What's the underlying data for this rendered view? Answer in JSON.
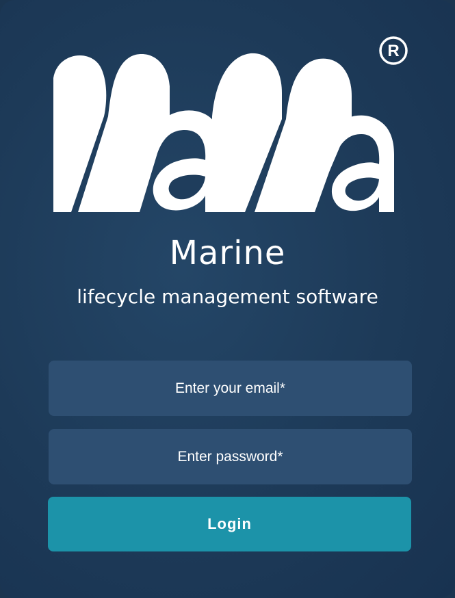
{
  "brand": {
    "logo_text": "MaMa",
    "registered_mark": "®",
    "title": "Marine",
    "subtitle": "lifecycle management software"
  },
  "login_form": {
    "email_placeholder": "Enter your email*",
    "password_placeholder": "Enter password*",
    "login_label": "Login"
  },
  "colors": {
    "background": "#1d3a58",
    "field": "#2e4f72",
    "accent": "#1c93a9",
    "text": "#ffffff"
  }
}
